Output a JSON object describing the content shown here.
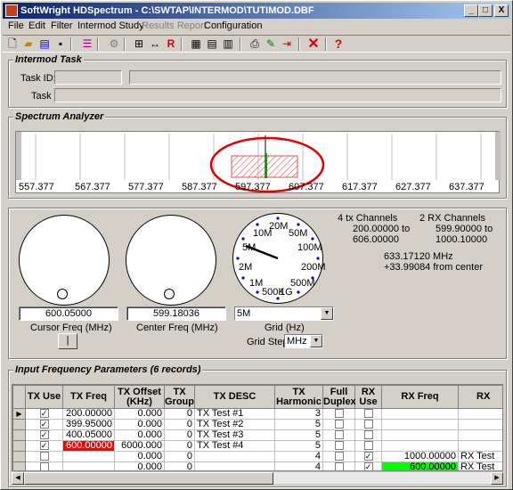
{
  "window": {
    "title": "SoftWright HDSpectrum - C:\\SWTAP\\INTERMOD\\TUTIMOD.DBF",
    "minimize": "_",
    "maximize": "□",
    "close": "X"
  },
  "menu": {
    "file": "File",
    "edit": "Edit",
    "filter": "Filter",
    "intermod_study": "Intermod Study",
    "results_report": "Results Report",
    "configuration": "Configuration"
  },
  "toolbar_icons": [
    "new-doc-icon",
    "open-folder-icon",
    "open-db-icon",
    "save-icon",
    "list-icon",
    "settings-icon",
    "add-record-icon",
    "span-icon",
    "R",
    "report-icon",
    "report2-icon",
    "report3-icon",
    "print-icon",
    "edit-icon",
    "export-icon",
    "delete-icon",
    "help-icon"
  ],
  "intermod_task": {
    "title": "Intermod Task",
    "task_id_label": "Task ID:",
    "task_label": "Task",
    "task_id_value": "",
    "task_id_extra": "",
    "task_value": ""
  },
  "spectrum_analyzer": {
    "title": "Spectrum Analyzer",
    "ticks": [
      "557.377",
      "567.377",
      "577.377",
      "587.377",
      "597.377",
      "607.377",
      "617.377",
      "627.377",
      "637.377"
    ]
  },
  "controls": {
    "cursor_freq": "600.05000",
    "cursor_freq_label": "Cursor Freq (MHz)",
    "center_freq": "599.18036",
    "center_freq_label": "Center Freq (MHz)",
    "grid_value": "5M",
    "grid_label": "Grid (Hz)",
    "grid_step_label": "Grid Step",
    "grid_step_value": "MHz",
    "button_label": "|",
    "dial_labels": [
      "20M",
      "50M",
      "10M",
      "100M",
      "5M",
      "200M",
      "2M",
      "500M",
      "1M",
      "500K",
      "1G"
    ],
    "tx_channels": "4 tx Channels",
    "tx_range_1": "200.00000 to",
    "tx_range_2": "606.00000",
    "rx_channels": "2 RX Channels",
    "rx_range_1": "599.90000 to",
    "rx_range_2": "1000.10000",
    "freq_display": "633.17120 MHz",
    "from_center": "+33.99084 from center"
  },
  "input_params": {
    "title": "Input Frequency Parameters (6 records)",
    "headers": [
      "TX Use",
      "TX Freq",
      "TX Offset (KHz)",
      "TX Group",
      "TX DESC",
      "TX Harmonic",
      "Full Duplex",
      "RX Use",
      "RX Freq",
      "RX"
    ],
    "rows": [
      {
        "indicator": "▶",
        "tx_use": "✓",
        "tx_freq": "200.00000",
        "tx_offset": "0.000",
        "tx_group": "0",
        "tx_desc": "TX Test #1",
        "harmonic": "3",
        "full_duplex": "",
        "rx_use": "",
        "rx_freq": "",
        "rx_desc": ""
      },
      {
        "indicator": "",
        "tx_use": "✓",
        "tx_freq": "399.95000",
        "tx_offset": "0.000",
        "tx_group": "0",
        "tx_desc": "TX Test #2",
        "harmonic": "5",
        "full_duplex": "",
        "rx_use": "",
        "rx_freq": "",
        "rx_desc": ""
      },
      {
        "indicator": "",
        "tx_use": "✓",
        "tx_freq": "400.05000",
        "tx_offset": "0.000",
        "tx_group": "0",
        "tx_desc": "TX Test #3",
        "harmonic": "5",
        "full_duplex": "",
        "rx_use": "",
        "rx_freq": "",
        "rx_desc": ""
      },
      {
        "indicator": "",
        "tx_use": "✓",
        "tx_freq": "600.00000",
        "tx_offset": "6000.000",
        "tx_group": "0",
        "tx_desc": "TX Test #4",
        "harmonic": "5",
        "full_duplex": "",
        "rx_use": "",
        "rx_freq": "",
        "rx_desc": ""
      },
      {
        "indicator": "",
        "tx_use": "",
        "tx_freq": "",
        "tx_offset": "0.000",
        "tx_group": "0",
        "tx_desc": "",
        "harmonic": "4",
        "full_duplex": "",
        "rx_use": "✓",
        "rx_freq": "1000.00000",
        "rx_desc": "RX Test"
      },
      {
        "indicator": "",
        "tx_use": "",
        "tx_freq": "",
        "tx_offset": "0.000",
        "tx_group": "0",
        "tx_desc": "",
        "harmonic": "4",
        "full_duplex": "",
        "rx_use": "✓",
        "rx_freq": "600.00000",
        "rx_desc": "RX Test"
      }
    ]
  },
  "colors": {
    "highlight_red": "#ff0000",
    "highlight_green": "#00ff00",
    "annotation_circle": "#e00000",
    "hatch": "#e05050"
  }
}
